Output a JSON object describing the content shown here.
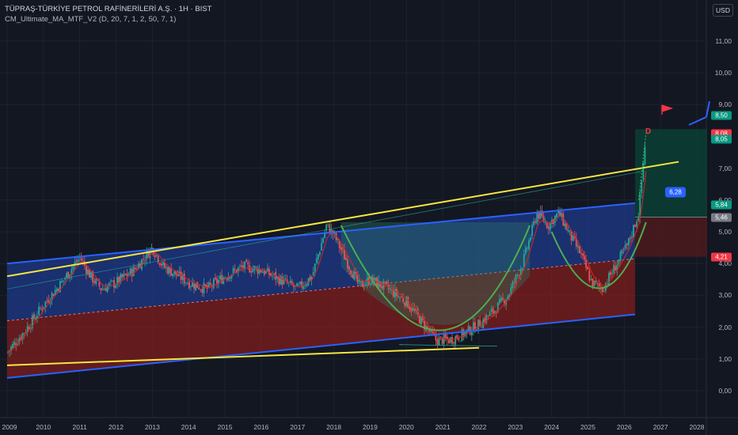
{
  "header": {
    "symbol_line": "TÜPRAŞ-TÜRKİYE PETROL RAFİNERİLERİ A.Ş. · 1H · BIST",
    "indicator_line": "CM_Ultimate_MA_MTF_V2 (D, 20, 7, 1, 2, 50, 7, 1)"
  },
  "currency_button": "USD",
  "price_axis": {
    "ticks": [
      "11,00",
      "10,00",
      "9,00",
      "7,00",
      "6,00",
      "5,00",
      "4,00",
      "3,00",
      "2,00",
      "1,00",
      "0,00"
    ],
    "tick_values": [
      11,
      10,
      9,
      7,
      6,
      5,
      4,
      3,
      2,
      1,
      0
    ]
  },
  "time_axis": {
    "ticks": [
      "2009",
      "2010",
      "2011",
      "2012",
      "2013",
      "2014",
      "2015",
      "2016",
      "2017",
      "2018",
      "2019",
      "2020",
      "2021",
      "2022",
      "2023",
      "2024",
      "2025",
      "2026",
      "2027",
      "2028"
    ]
  },
  "price_labels": [
    {
      "text": "8,50",
      "value": 8.5,
      "color": "#089981"
    },
    {
      "text": "8,08",
      "value": 8.08,
      "color": "#f23645"
    },
    {
      "text": "8,05",
      "value": 8.05,
      "color": "#089981"
    },
    {
      "text": "5,84",
      "value": 5.84,
      "color": "#089981"
    },
    {
      "text": "5,46",
      "value": 5.46,
      "color": "#787b86"
    },
    {
      "text": "4,21",
      "value": 4.21,
      "color": "#f23645"
    }
  ],
  "position_label": "6,28",
  "point_label": "D",
  "colors": {
    "background": "#131722",
    "channel_upper": "#2962ff",
    "channel_fill_top": "#1e3a8a",
    "channel_fill_bottom": "#7f1d1d",
    "trendline": "#f5e642",
    "arc": "#4caf50",
    "candle_up": "#26a69a",
    "candle_down": "#ef5350",
    "profit_zone": "#0b3d33",
    "loss_zone": "#4a1a1e"
  },
  "chart_data": {
    "type": "line",
    "symbol": "TUPRS",
    "x_range": [
      2009,
      2028
    ],
    "y_range": [
      0,
      11
    ],
    "close_series": {
      "x": [
        2009.0,
        2009.5,
        2010.0,
        2010.5,
        2011.0,
        2011.3,
        2011.6,
        2012.0,
        2012.5,
        2013.0,
        2013.3,
        2013.6,
        2014.0,
        2014.5,
        2015.0,
        2015.5,
        2016.0,
        2016.5,
        2017.0,
        2017.4,
        2017.8,
        2018.0,
        2018.3,
        2018.7,
        2019.0,
        2019.5,
        2020.0,
        2020.4,
        2020.8,
        2021.2,
        2021.6,
        2022.0,
        2022.4,
        2022.8,
        2023.2,
        2023.6,
        2023.9,
        2024.2,
        2024.5,
        2024.8,
        2025.1,
        2025.4,
        2025.8,
        2026.1,
        2026.4,
        2026.6
      ],
      "y": [
        1.2,
        1.9,
        2.7,
        3.4,
        4.2,
        3.6,
        3.2,
        3.4,
        3.8,
        4.5,
        3.9,
        3.7,
        3.4,
        3.2,
        3.6,
        3.9,
        3.8,
        3.5,
        3.2,
        3.6,
        5.2,
        4.9,
        4.2,
        3.3,
        3.5,
        3.2,
        2.8,
        2.2,
        1.6,
        1.6,
        1.8,
        2.1,
        2.5,
        3.0,
        4.0,
        5.6,
        5.2,
        5.6,
        4.9,
        4.3,
        3.4,
        3.2,
        4.0,
        4.6,
        5.6,
        8.1
      ]
    },
    "channel": {
      "upper_start": [
        2009,
        4.0
      ],
      "upper_end": [
        2026.3,
        5.9
      ],
      "lower_start": [
        2009,
        0.4
      ],
      "lower_end": [
        2026.3,
        2.4
      ]
    },
    "trendlines": [
      {
        "from": [
          2009,
          3.6
        ],
        "to": [
          2027.5,
          7.2
        ]
      },
      {
        "from": [
          2009,
          0.8
        ],
        "to": [
          2022,
          1.35
        ]
      }
    ],
    "long_position": {
      "entry": 5.46,
      "target": 8.05,
      "stop": 4.21,
      "start_x": 2026.3,
      "end_x": 2028.6
    }
  }
}
